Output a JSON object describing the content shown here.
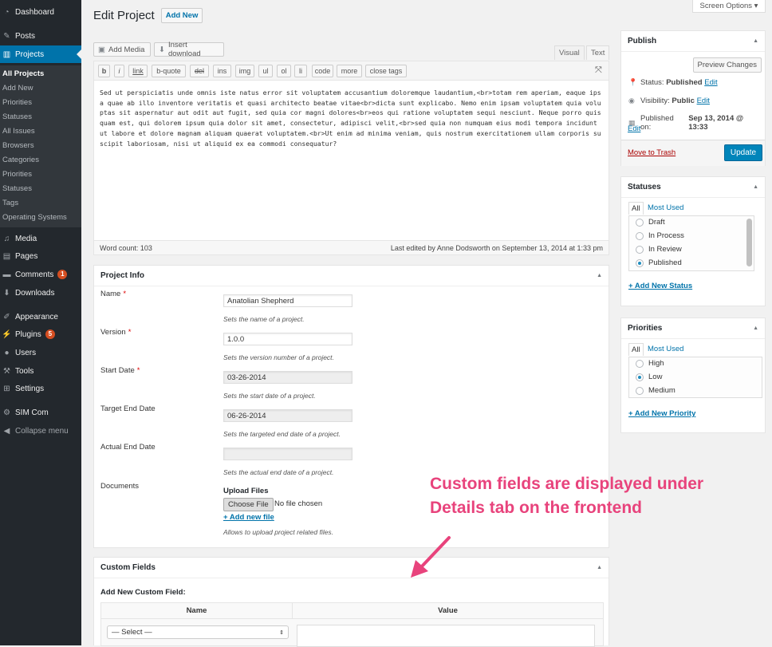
{
  "sidebar": {
    "menu": [
      {
        "label": "Dashboard",
        "icon": "dashboard-icon",
        "glyph": "◔"
      },
      {
        "label": "Posts",
        "icon": "pin-icon",
        "glyph": "✎"
      },
      {
        "label": "Projects",
        "icon": "projects-icon",
        "glyph": "▥"
      },
      {
        "label": "Media",
        "icon": "media-icon",
        "glyph": "♫"
      },
      {
        "label": "Pages",
        "icon": "pages-icon",
        "glyph": "▤"
      },
      {
        "label": "Comments",
        "icon": "comments-icon",
        "glyph": "▬",
        "badge": "1"
      },
      {
        "label": "Downloads",
        "icon": "downloads-icon",
        "glyph": "⬇"
      },
      {
        "label": "Appearance",
        "icon": "appearance-icon",
        "glyph": "✐"
      },
      {
        "label": "Plugins",
        "icon": "plugins-icon",
        "glyph": "⚡",
        "badge": "5"
      },
      {
        "label": "Users",
        "icon": "users-icon",
        "glyph": "●"
      },
      {
        "label": "Tools",
        "icon": "tools-icon",
        "glyph": "⚒"
      },
      {
        "label": "Settings",
        "icon": "settings-icon",
        "glyph": "⊞"
      },
      {
        "label": "SIM Com",
        "icon": "simcom-icon",
        "glyph": "⚙"
      },
      {
        "label": "Collapse menu",
        "icon": "collapse-icon",
        "glyph": "◀"
      }
    ],
    "submenu": [
      "All Projects",
      "Add New",
      "Priorities",
      "Statuses",
      "All Issues",
      "Browsers",
      "Categories",
      "Priorities",
      "Statuses",
      "Tags",
      "Operating Systems"
    ]
  },
  "header": {
    "title": "Edit Project",
    "add_new": "Add New",
    "screen_options": "Screen Options ▾"
  },
  "editor": {
    "add_media": "Add Media",
    "insert_download": "Insert download",
    "tab_visual": "Visual",
    "tab_text": "Text",
    "quicktags": [
      "b",
      "i",
      "link",
      "b-quote",
      "del",
      "ins",
      "img",
      "ul",
      "ol",
      "li",
      "code",
      "more",
      "close tags"
    ],
    "content": "Sed ut perspiciatis unde omnis iste natus error sit voluptatem accusantium doloremque laudantium,<br>totam rem aperiam, eaque ipsa quae ab illo inventore veritatis et quasi architecto beatae vitae<br>dicta sunt explicabo. Nemo enim ipsam voluptatem quia voluptas sit aspernatur aut odit aut fugit, sed quia cor magni dolores<br>eos qui ratione voluptatem sequi nesciunt. Neque porro quisquam est, qui dolorem ipsum quia dolor sit amet, consectetur, adipisci velit,<br>sed quia non numquam eius modi tempora incidunt ut labore et dolore magnam aliquam quaerat voluptatem.<br>Ut enim ad minima veniam, quis nostrum exercitationem ullam corporis suscipit laboriosam, nisi ut aliquid ex ea commodi consequatur?",
    "word_count": "Word count: 103",
    "last_edited": "Last edited by Anne Dodsworth on September 13, 2014 at 1:33 pm"
  },
  "project_info": {
    "title": "Project Info",
    "fields": [
      {
        "label": "Name",
        "required": "*",
        "value": "Anatolian Shepherd",
        "hint": "Sets the name of a project."
      },
      {
        "label": "Version",
        "required": "*",
        "value": "1.0.0",
        "hint": "Sets the version number of a project."
      },
      {
        "label": "Start Date",
        "required": "*",
        "value": "03-26-2014",
        "hint": "Sets the start date of a project."
      },
      {
        "label": "Target End Date",
        "required": "",
        "value": "06-26-2014",
        "hint": "Sets the targeted end date of a project."
      },
      {
        "label": "Actual End Date",
        "required": "",
        "value": "",
        "hint": "Sets the actual end date of a project."
      }
    ],
    "documents_label": "Documents",
    "upload_label": "Upload Files",
    "choose_file": "Choose File",
    "no_file": "No file chosen",
    "add_new_file": "+ Add new file",
    "documents_hint": "Allows to upload project related files."
  },
  "custom_fields": {
    "title": "Custom Fields",
    "add_new_label": "Add New Custom Field:",
    "col_name": "Name",
    "col_value": "Value",
    "select": "— Select —"
  },
  "publish": {
    "title": "Publish",
    "preview": "Preview Changes",
    "status_label": "Status:",
    "status_value": "Published",
    "visibility_label": "Visibility:",
    "visibility_value": "Public",
    "published_label": "Published on:",
    "published_value": "Sep 13, 2014 @ 13:33",
    "edit": "Edit",
    "trash": "Move to Trash",
    "update": "Update"
  },
  "statuses": {
    "title": "Statuses",
    "tab_all": "All",
    "tab_most_used": "Most Used",
    "options": [
      "Draft",
      "In Process",
      "In Review",
      "Published"
    ],
    "selected": 3,
    "add_new": "+ Add New Status"
  },
  "priorities": {
    "title": "Priorities",
    "tab_all": "All",
    "tab_most_used": "Most Used",
    "options": [
      "High",
      "Low",
      "Medium"
    ],
    "selected": 1,
    "add_new": "+ Add New Priority"
  },
  "annotation": {
    "line1": "Custom fields are displayed under",
    "line2": "Details tab on the frontend"
  },
  "colors": {
    "accent": "#0073aa",
    "sidebar": "#23282d",
    "annotation": "#e8437c",
    "badge": "#d54e21"
  }
}
